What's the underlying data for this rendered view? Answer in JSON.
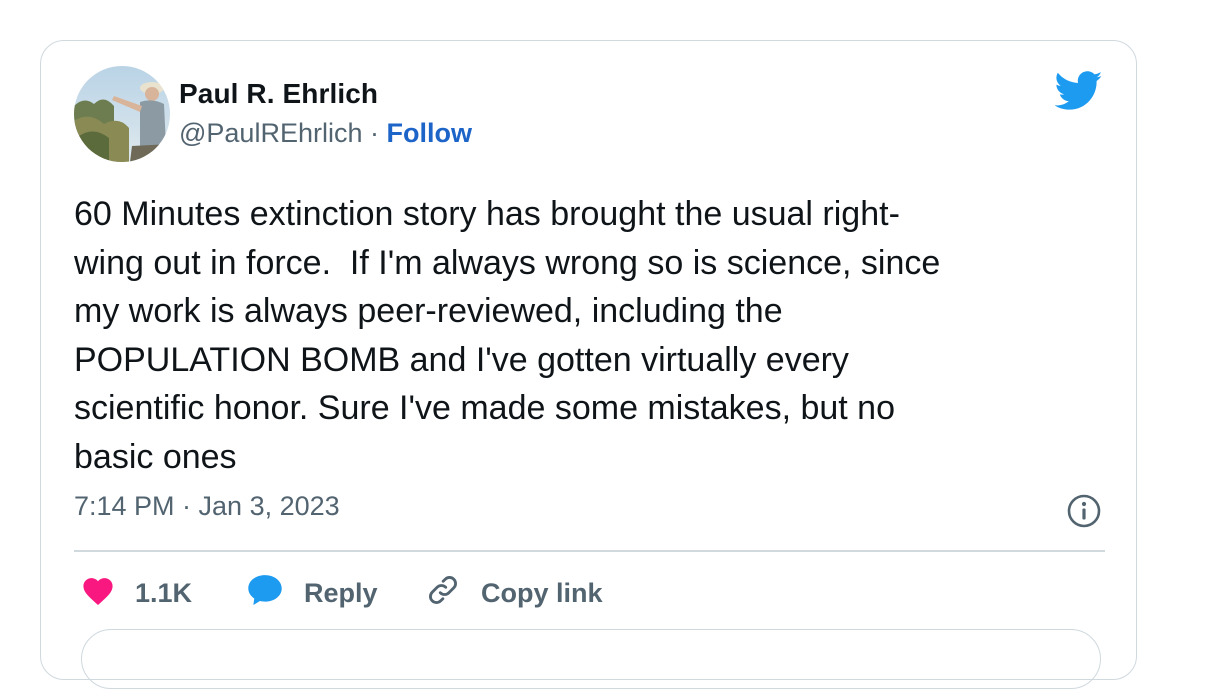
{
  "tweet": {
    "author": {
      "name": "Paul R. Ehrlich",
      "handle": "@PaulREhrlich",
      "separator": "·",
      "follow_label": "Follow"
    },
    "text": "60 Minutes extinction story has brought the usual right-\nwing out in force.  If I'm always wrong so is science, since\nmy work is always peer-reviewed, including the\nPOPULATION BOMB and I've gotten virtually every\nscientific honor. Sure I've made some mistakes, but no\nbasic ones",
    "timestamp": "7:14 PM · Jan 3, 2023",
    "actions": {
      "like_count": "1.1K",
      "reply_label": "Reply",
      "copy_link_label": "Copy link"
    }
  },
  "icons": {
    "brand": "twitter-bird-icon",
    "like": "heart-icon",
    "reply": "speech-bubble-icon",
    "copy": "link-icon",
    "info": "info-icon"
  },
  "colors": {
    "brand_blue": "#1d9bf0",
    "follow_blue": "#1d64c8",
    "like_pink": "#f91880",
    "secondary_text": "#536471",
    "primary_text": "#0f1419",
    "border": "#cfd9de"
  }
}
